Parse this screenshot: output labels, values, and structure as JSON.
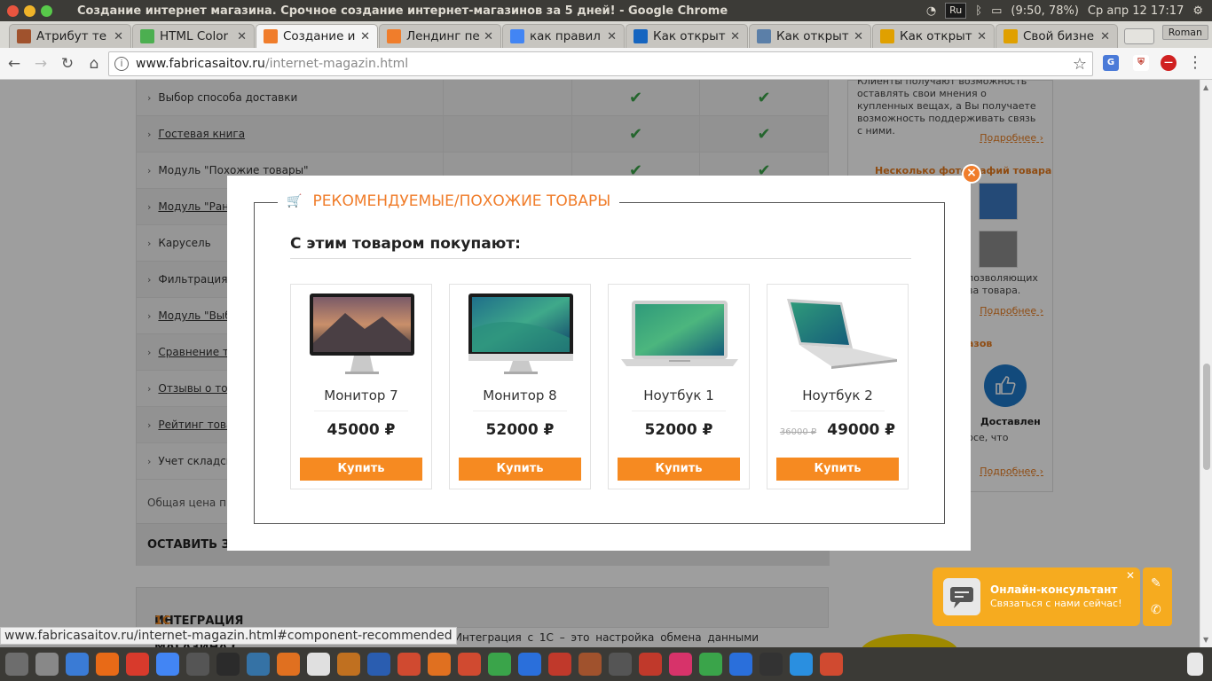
{
  "system": {
    "window_title": "Создание интернет магазина. Срочное создание интернет-магазинов за 5 дней! - Google Chrome",
    "lang": "Ru",
    "battery": "(9:50, 78%)",
    "clock": "Ср апр 12 17:17",
    "user": "Roman"
  },
  "tabs": [
    {
      "label": "Атрибут те",
      "icon": "page-icon",
      "color": "#a0522d"
    },
    {
      "label": "HTML Color",
      "icon": "color-icon",
      "color": "#4caf50"
    },
    {
      "label": "Создание и",
      "icon": "site-icon",
      "color": "#f07d2b"
    },
    {
      "label": "Лендинг пе",
      "icon": "site-icon",
      "color": "#f07d2b"
    },
    {
      "label": "как правил",
      "icon": "google-icon",
      "color": "#4285f4"
    },
    {
      "label": "Как открыт",
      "icon": "site-icon",
      "color": "#1565c0"
    },
    {
      "label": "Как открыт",
      "icon": "site-icon",
      "color": "#5b7fa8"
    },
    {
      "label": "Как открыт",
      "icon": "site-icon",
      "color": "#e0a000"
    },
    {
      "label": "Свой бизне",
      "icon": "site-icon",
      "color": "#e0a000"
    }
  ],
  "address": {
    "host": "www.fabricasaitov.ru",
    "path": "/internet-magazin.html"
  },
  "features": [
    {
      "label": "Выбор способа доставки",
      "underline": false,
      "c3": "✔",
      "c4": "✔"
    },
    {
      "label": "Гостевая книга",
      "underline": true,
      "c3": "✔",
      "c4": "✔"
    },
    {
      "label": "Модуль \"Похожие товары\"",
      "underline": false,
      "c3": "✔",
      "c4": "✔"
    },
    {
      "label": "Модуль \"Ранее",
      "underline": true,
      "c3": "",
      "c4": ""
    },
    {
      "label": "Карусель",
      "underline": false,
      "c3": "",
      "c4": ""
    },
    {
      "label": "Фильтрация п",
      "underline": false,
      "c3": "",
      "c4": ""
    },
    {
      "label": "Модуль \"Выбо",
      "underline": true,
      "c3": "",
      "c4": ""
    },
    {
      "label": "Сравнение то",
      "underline": true,
      "c3": "",
      "c4": ""
    },
    {
      "label": "Отзывы о тов",
      "underline": true,
      "c3": "",
      "c4": ""
    },
    {
      "label": "Рейтинг товар",
      "underline": true,
      "c3": "",
      "c4": ""
    },
    {
      "label": "Учет складск",
      "underline": false,
      "c3": "",
      "c4": ""
    }
  ],
  "total_label": "Общая цена пр",
  "order_label": "ОСТАВИТЬ ЗА",
  "integration": {
    "title": "ИНТЕГРАЦИЯ ИНТЕРНЕТ-МАГАЗИНА С",
    "highlight": "1С",
    "text": "Интеграция с 1С – это настройка обмена данными"
  },
  "sidebar": {
    "text1": "Клиенты получают возможность оставлять свои мнения о купленных вещах, а Вы получаете возможность поддерживать связь с ними.",
    "more1": "Подробнее ›",
    "heading2": "Несколько фотографий товара",
    "text2": "позволяющих ва товара.",
    "more2": "Подробнее ›",
    "heading3": "азов",
    "like_label": "Доставлен",
    "text3": "рсе, что",
    "more3": "Подробнее ›"
  },
  "modal": {
    "legend": "РЕКОМЕНДУЕМЫЕ/ПОХОЖИЕ ТОВАРЫ",
    "subtitle": "С этим товаром покупают:",
    "products": [
      {
        "name": "Монитор 7",
        "price": "45000 ₽",
        "old_price": "",
        "buy": "Купить",
        "kind": "monitor-mountain"
      },
      {
        "name": "Монитор 8",
        "price": "52000 ₽",
        "old_price": "",
        "buy": "Купить",
        "kind": "monitor-wave"
      },
      {
        "name": "Ноутбук 1",
        "price": "52000 ₽",
        "old_price": "",
        "buy": "Купить",
        "kind": "laptop-front"
      },
      {
        "name": "Ноутбук 2",
        "price": "49000 ₽",
        "old_price": "36000 ₽",
        "buy": "Купить",
        "kind": "laptop-side"
      }
    ]
  },
  "consultant": {
    "title": "Онлайн-консультант",
    "subtitle": "Связаться с нами сейчас!"
  },
  "status_url": "www.fabricasaitov.ru/internet-magazin.html#component-recommended",
  "taskbar_colors": [
    "#6d6d6d",
    "#888",
    "#3a7bd5",
    "#e86a17",
    "#d83a2c",
    "#4285f4",
    "#555",
    "#2b2b2b",
    "#3572a5",
    "#e07020",
    "#e0e0e0",
    "#c07020",
    "#2a5db0",
    "#d04a30",
    "#e07020",
    "#d04a30",
    "#3aa44a",
    "#2a6fdb",
    "#c0392b",
    "#a0522d",
    "#555",
    "#c0392b",
    "#d7336a",
    "#3aa44a",
    "#2a6fdb",
    "#333",
    "#2a8fe0",
    "#d04a30"
  ]
}
